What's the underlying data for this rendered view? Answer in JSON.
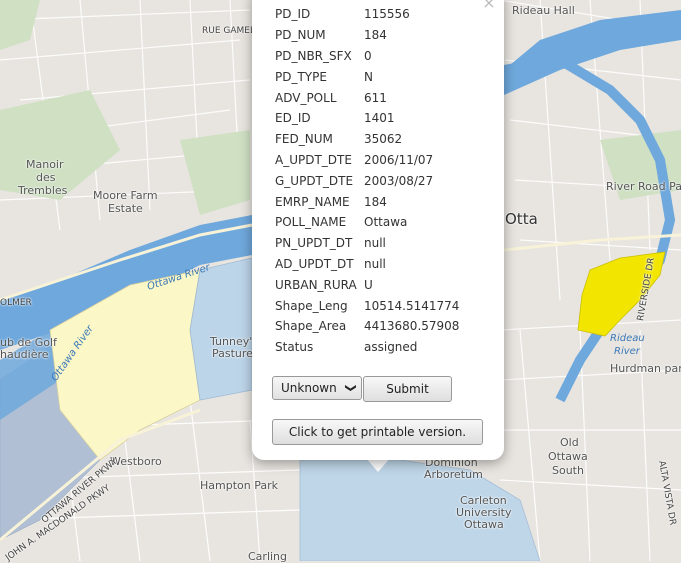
{
  "map": {
    "labels": {
      "rue_gamelin": "RUE GAMELIN",
      "rideau_hall": "Rideau Hall",
      "manoir": "Manoir",
      "des": "des",
      "trembles": "Trembles",
      "moore_farm": "Moore Farm",
      "estate": "Estate",
      "river_road_park": "River Road Park",
      "ottawa": "Ottawa",
      "ottawa_river": "Ottawa River",
      "ottawa_river_2": "Ottawa River",
      "tunneys": "Tunney's",
      "pasture": "Pasture",
      "golf": "ub de Golf",
      "chaudiere": "haudière",
      "olmer": "OLMER",
      "rideau": "Rideau",
      "river": "River",
      "hurdman_park": "Hurdman park",
      "riverside_dr": "RIVERSIDE DR",
      "westboro": "Westboro",
      "hampton_park": "Hampton Park",
      "dominion": "Dominion",
      "arboretum": "Arboretum",
      "carleton": "Carleton",
      "university": "University",
      "ottawa2": "Ottawa",
      "old": "Old",
      "ottawa_south": "Ottawa",
      "south": "South",
      "alta_vista": "ALTA VISTA DR",
      "carling": "Carling",
      "john_a": "JOHN A. MACDONALD PKWY",
      "ottawa_river_pkwy": "OTTAWA RIVER PKWY",
      "ottawa_e": "Otta"
    }
  },
  "popup": {
    "close_symbol": "×",
    "attributes": [
      {
        "key": "PD_ID",
        "value": "115556"
      },
      {
        "key": "PD_NUM",
        "value": "184"
      },
      {
        "key": "PD_NBR_SFX",
        "value": "0"
      },
      {
        "key": "PD_TYPE",
        "value": "N"
      },
      {
        "key": "ADV_POLL",
        "value": "611"
      },
      {
        "key": "ED_ID",
        "value": "1401"
      },
      {
        "key": "FED_NUM",
        "value": "35062"
      },
      {
        "key": "A_UPDT_DTE",
        "value": "2006/11/07"
      },
      {
        "key": "G_UPDT_DTE",
        "value": "2003/08/27"
      },
      {
        "key": "EMRP_NAME",
        "value": "184"
      },
      {
        "key": "POLL_NAME",
        "value": "Ottawa"
      },
      {
        "key": "PN_UPDT_DT",
        "value": "null"
      },
      {
        "key": "AD_UPDT_DT",
        "value": "null"
      },
      {
        "key": "URBAN_RURA",
        "value": "U"
      },
      {
        "key": "Shape_Leng",
        "value": "10514.5141774"
      },
      {
        "key": "Shape_Area",
        "value": "4413680.57908"
      },
      {
        "key": "Status",
        "value": "assigned"
      }
    ],
    "status_select": {
      "selected": "Unknown",
      "chevron": "❯"
    },
    "submit_label": "Submit",
    "print_label": "Click to get printable version."
  },
  "colors": {
    "land": "#e8e5e0",
    "park": "#cfe0c3",
    "water": "#6fa8dc",
    "polygon_yellow_pale": "#fbf7c6",
    "polygon_blue_pale": "#b9d4ea",
    "polygon_yellow": "#f2e600",
    "polygon_grey_blue": "#b0bfd3"
  }
}
